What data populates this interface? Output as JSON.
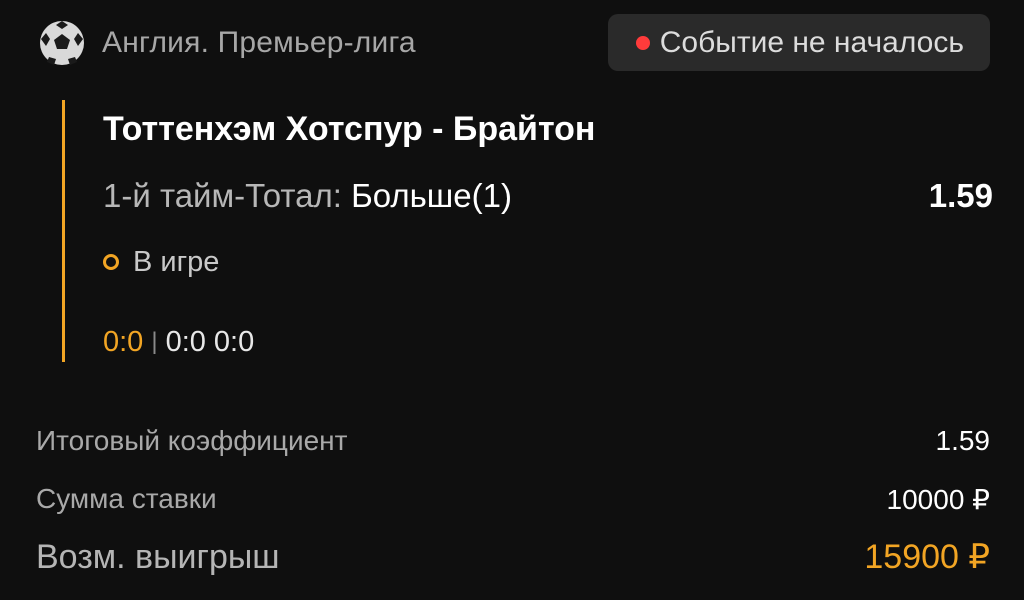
{
  "header": {
    "league": "Англия. Премьер-лига",
    "league_icon": "soccer-ball-icon",
    "status": "Событие не началось",
    "status_dot_color": "#ff3b3b"
  },
  "event": {
    "title": "Тоттенхэм Хотспур - Брайтон",
    "market": "1-й тайм-Тотал:",
    "outcome": "Больше(1)",
    "odds": "1.59",
    "live_label": "В игре",
    "score_main": "0:0",
    "score_separator": "|",
    "score_detail": "0:0 0:0",
    "accent_color": "#f2a524"
  },
  "summary": {
    "total_odds_label": "Итоговый коэффициент",
    "total_odds_value": "1.59",
    "stake_label": "Сумма ставки",
    "stake_value": "10000 ₽",
    "win_label": "Возм. выигрыш",
    "win_value": "15900 ₽"
  }
}
